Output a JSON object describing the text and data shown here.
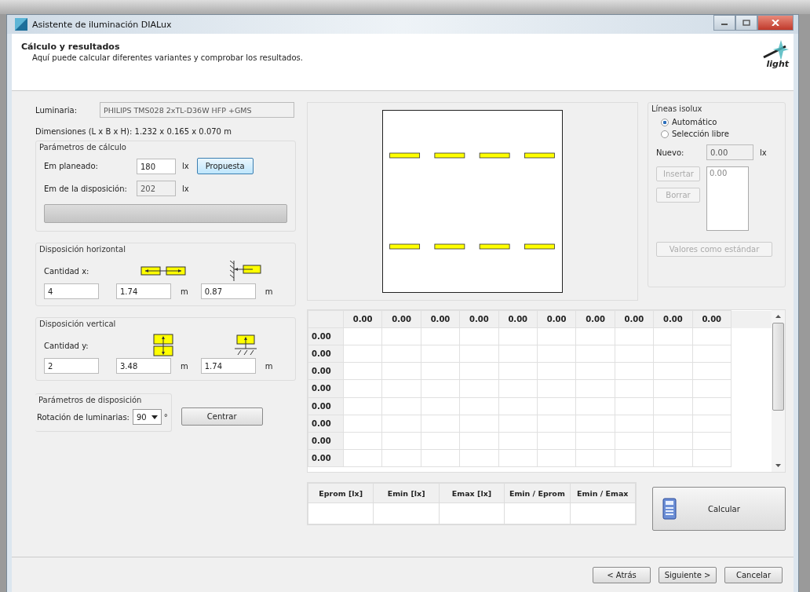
{
  "window": {
    "title": "Asistente de iluminación DIALux"
  },
  "header": {
    "title": "Cálculo y resultados",
    "subtitle": "Aquí puede calcular diferentes variantes y comprobar los resultados.",
    "logo_text": "light"
  },
  "luminaire": {
    "label": "Luminaria:",
    "value": "PHILIPS  TMS028 2xTL-D36W HFP +GMS",
    "disabled": true
  },
  "dimensions": "Dimensiones (L x B x H): 1.232 x 0.165 x 0.070 m",
  "calc_params": {
    "title": "Parámetros de cálculo",
    "planned": {
      "label": "Em planeado:",
      "value": "180",
      "unit": "lx",
      "disabled": false
    },
    "proposal_button": "Propuesta",
    "layout_value": {
      "label": "Em de la disposición:",
      "value": "202",
      "unit": "lx",
      "disabled": true
    },
    "progress": {
      "level": 0
    }
  },
  "horizontal": {
    "title": "Disposición horizontal",
    "quantity_label": "Cantidad x:",
    "quantity": "4",
    "spacing": "1.74",
    "spacing_unit": "m",
    "wall": "0.87",
    "wall_unit": "m"
  },
  "vertical": {
    "title": "Disposición vertical",
    "quantity_label": "Cantidad y:",
    "quantity": "2",
    "spacing": "3.48",
    "spacing_unit": "m",
    "wall": "1.74",
    "wall_unit": "m"
  },
  "layout_params": {
    "title": "Parámetros de disposición",
    "rotation_label": "Rotación de luminarias:",
    "rotation": "90",
    "degree": "°",
    "center_button": "Centrar"
  },
  "isolux": {
    "title": "Líneas isolux",
    "options": [
      {
        "label": "Automático",
        "selected": true
      },
      {
        "label": "Selección libre",
        "selected": false
      }
    ],
    "new_label": "Nuevo:",
    "new_value": "0.00",
    "new_unit": "lx",
    "new_disabled": true,
    "insert_button": {
      "label": "Insertar",
      "disabled": true
    },
    "delete_button": {
      "label": "Borrar",
      "disabled": true
    },
    "list": [
      "0.00"
    ],
    "default_button": {
      "label": "Valores como estándar",
      "disabled": true
    }
  },
  "grid": {
    "columns": [
      "0.00",
      "0.00",
      "0.00",
      "0.00",
      "0.00",
      "0.00",
      "0.00",
      "0.00",
      "0.00",
      "0.00"
    ],
    "rows": [
      "0.00",
      "0.00",
      "0.00",
      "0.00",
      "0.00",
      "0.00",
      "0.00",
      "0.00"
    ]
  },
  "results": {
    "columns": [
      "Eprom [lx]",
      "Emin [lx]",
      "Emax [lx]",
      "Emin / Eprom",
      "Emin / Emax"
    ]
  },
  "calculate_button": "Calcular",
  "footer": {
    "buttons": [
      "< Atrás",
      "Siguiente >",
      "Cancelar"
    ]
  }
}
